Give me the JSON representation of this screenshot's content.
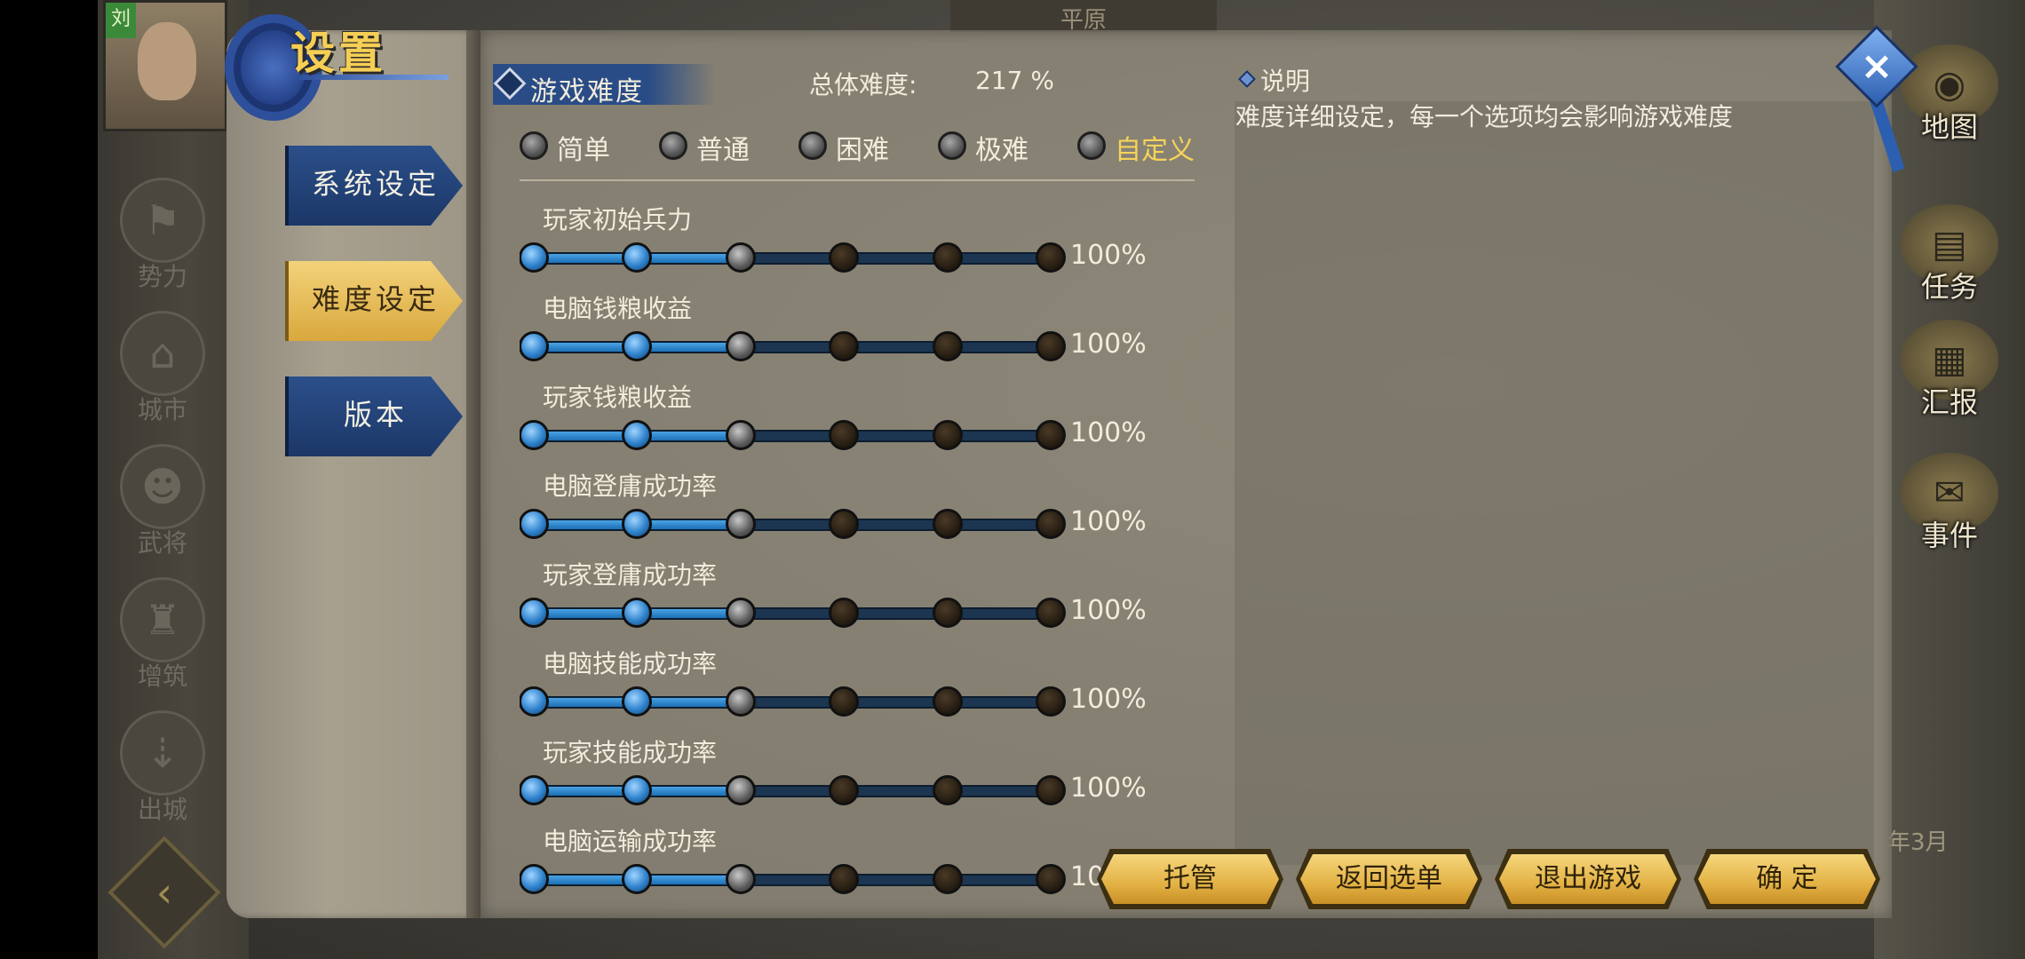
{
  "background": {
    "top_location": "平原",
    "avatar_tag": "刘",
    "left_nav": [
      {
        "label": "势力",
        "icon": "faction-icon"
      },
      {
        "label": "城市",
        "icon": "city-icon"
      },
      {
        "label": "武将",
        "icon": "general-icon"
      },
      {
        "label": "增筑",
        "icon": "build-icon"
      },
      {
        "label": "出城",
        "icon": "sortie-icon"
      }
    ],
    "right_nav": [
      {
        "label": "地图",
        "icon": "map-icon"
      },
      {
        "label": "任务",
        "icon": "task-icon"
      },
      {
        "label": "汇报",
        "icon": "report-icon"
      },
      {
        "label": "事件",
        "icon": "event-icon"
      }
    ],
    "date_partial": "年3月"
  },
  "panel": {
    "title": "设置",
    "tabs": [
      {
        "label": "系统设定",
        "active": false
      },
      {
        "label": "难度设定",
        "active": true
      },
      {
        "label": "版本",
        "active": false
      }
    ],
    "section_title": "游戏难度",
    "overall_label": "总体难度:",
    "overall_value": "217 %",
    "presets": [
      {
        "label": "简单",
        "selected": false
      },
      {
        "label": "普通",
        "selected": false
      },
      {
        "label": "困难",
        "selected": false
      },
      {
        "label": "极难",
        "selected": false
      },
      {
        "label": "自定义",
        "selected": true
      }
    ],
    "options": [
      {
        "label": "玩家初始兵力",
        "value": "100%",
        "level": 2
      },
      {
        "label": "电脑钱粮收益",
        "value": "100%",
        "level": 2
      },
      {
        "label": "玩家钱粮收益",
        "value": "100%",
        "level": 2
      },
      {
        "label": "电脑登庸成功率",
        "value": "100%",
        "level": 2
      },
      {
        "label": "玩家登庸成功率",
        "value": "100%",
        "level": 2
      },
      {
        "label": "电脑技能成功率",
        "value": "100%",
        "level": 2
      },
      {
        "label": "玩家技能成功率",
        "value": "100%",
        "level": 2
      },
      {
        "label": "电脑运输成功率",
        "value": "100%",
        "level": 2
      }
    ],
    "slider_steps": 6,
    "description_header": "说明",
    "description_text": "难度详细设定，每一个选项均会影响游戏难度",
    "buttons": {
      "auto": "托管",
      "back_menu": "返回选单",
      "exit_game": "退出游戏",
      "confirm": "确 定"
    },
    "close_icon": "close-icon"
  },
  "colors": {
    "accent_gold": "#f6d35a",
    "tab_blue": "#2b4f8a",
    "slider_blue": "#2f82cc"
  }
}
